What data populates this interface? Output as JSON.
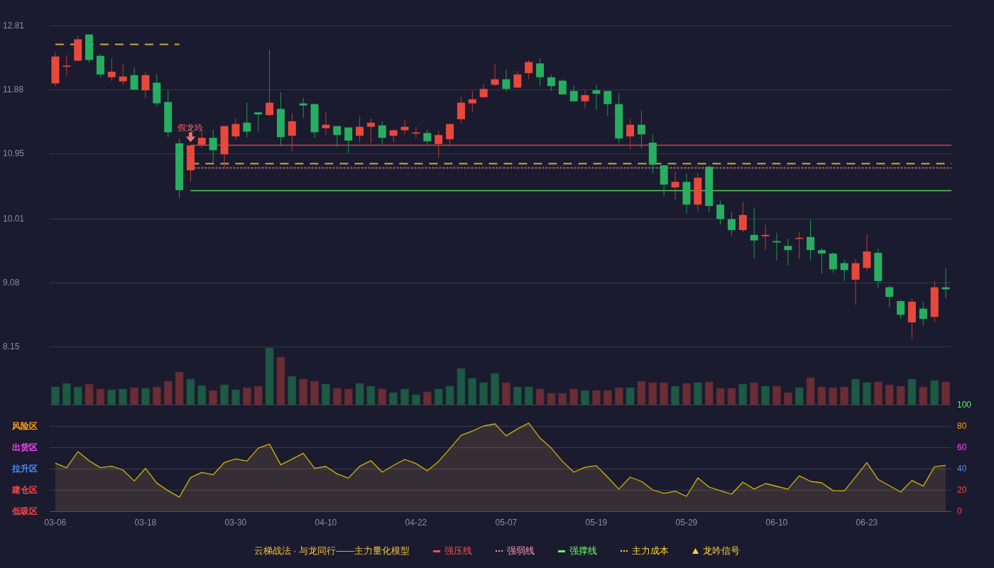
{
  "price_chart": {
    "chart_data": {
      "type": "candlestick",
      "categories": [
        null,
        null,
        null,
        null,
        null,
        null,
        null,
        null,
        null,
        null,
        null,
        null,
        null,
        null,
        null,
        null,
        null,
        null,
        null,
        null,
        null,
        null,
        null,
        null,
        null,
        null,
        null,
        null,
        null,
        null,
        null,
        null,
        null,
        null,
        null,
        null,
        null,
        null,
        null,
        null,
        null,
        null,
        null,
        null,
        null,
        null,
        null,
        null,
        null,
        null,
        null,
        null,
        null,
        null,
        null,
        null,
        null,
        null,
        null,
        null,
        null,
        null,
        null,
        null,
        null,
        null,
        null,
        null,
        null,
        null,
        null,
        null,
        null,
        null,
        null,
        null,
        null,
        null,
        null,
        null
      ],
      "ohlc": [
        [
          11.97,
          12.42,
          11.93,
          12.36
        ],
        [
          12.21,
          12.38,
          12.08,
          12.22
        ],
        [
          12.3,
          12.66,
          12.29,
          12.61
        ],
        [
          12.68,
          12.68,
          12.27,
          12.31
        ],
        [
          12.37,
          12.4,
          12.06,
          12.1
        ],
        [
          12.06,
          12.33,
          12.01,
          12.14
        ],
        [
          12.0,
          12.25,
          11.95,
          12.07
        ],
        [
          12.09,
          12.2,
          11.88,
          11.88
        ],
        [
          11.87,
          12.14,
          11.76,
          12.09
        ],
        [
          11.98,
          12.1,
          11.63,
          11.68
        ],
        [
          11.7,
          11.87,
          11.19,
          11.26
        ],
        [
          11.1,
          11.17,
          10.31,
          10.42
        ],
        [
          10.71,
          11.07,
          10.54,
          11.07
        ],
        [
          11.08,
          11.31,
          11.03,
          11.18
        ],
        [
          11.18,
          11.3,
          10.82,
          11.0
        ],
        [
          10.94,
          11.35,
          10.76,
          11.35
        ],
        [
          11.2,
          11.46,
          11.15,
          11.38
        ],
        [
          11.4,
          11.69,
          11.19,
          11.27
        ],
        [
          11.55,
          11.55,
          11.27,
          11.52
        ],
        [
          11.51,
          12.46,
          11.5,
          11.69
        ],
        [
          11.6,
          11.84,
          11.06,
          11.19
        ],
        [
          11.21,
          11.54,
          10.99,
          11.42
        ],
        [
          11.68,
          11.76,
          11.47,
          11.65
        ],
        [
          11.67,
          11.67,
          11.18,
          11.26
        ],
        [
          11.32,
          11.55,
          11.22,
          11.37
        ],
        [
          11.35,
          11.35,
          11.05,
          11.22
        ],
        [
          11.33,
          11.33,
          10.96,
          11.14
        ],
        [
          11.21,
          11.49,
          11.11,
          11.34
        ],
        [
          11.34,
          11.46,
          11.1,
          11.4
        ],
        [
          11.36,
          11.42,
          11.08,
          11.18
        ],
        [
          11.21,
          11.3,
          11.12,
          11.29
        ],
        [
          11.29,
          11.44,
          11.22,
          11.34
        ],
        [
          11.24,
          11.34,
          11.18,
          11.25
        ],
        [
          11.25,
          11.3,
          11.07,
          11.13
        ],
        [
          11.09,
          11.28,
          10.89,
          11.22
        ],
        [
          11.16,
          11.39,
          11.05,
          11.38
        ],
        [
          11.45,
          11.78,
          11.39,
          11.69
        ],
        [
          11.68,
          11.86,
          11.56,
          11.74
        ],
        [
          11.77,
          11.96,
          11.76,
          11.89
        ],
        [
          11.95,
          12.25,
          11.93,
          12.03
        ],
        [
          12.03,
          12.17,
          11.85,
          11.89
        ],
        [
          11.91,
          12.15,
          11.9,
          12.1
        ],
        [
          12.12,
          12.31,
          12.03,
          12.28
        ],
        [
          12.26,
          12.33,
          11.93,
          12.06
        ],
        [
          12.06,
          12.1,
          11.86,
          11.93
        ],
        [
          12.01,
          12.03,
          11.81,
          11.81
        ],
        [
          11.86,
          11.94,
          11.7,
          11.71
        ],
        [
          11.71,
          11.87,
          11.61,
          11.8
        ],
        [
          11.87,
          11.95,
          11.59,
          11.82
        ],
        [
          11.86,
          11.86,
          11.5,
          11.67
        ],
        [
          11.67,
          11.83,
          11.1,
          11.17
        ],
        [
          11.2,
          11.46,
          11.01,
          11.37
        ],
        [
          11.37,
          11.57,
          11.03,
          11.23
        ],
        [
          11.11,
          11.23,
          10.66,
          10.79
        ],
        [
          10.78,
          10.79,
          10.33,
          10.5
        ],
        [
          10.46,
          10.69,
          10.28,
          10.54
        ],
        [
          10.54,
          10.66,
          10.08,
          10.21
        ],
        [
          10.21,
          10.67,
          10.11,
          10.6
        ],
        [
          10.76,
          10.78,
          10.1,
          10.19
        ],
        [
          10.21,
          10.27,
          9.92,
          10.0
        ],
        [
          10.0,
          10.1,
          9.76,
          9.84
        ],
        [
          9.84,
          10.25,
          9.81,
          10.06
        ],
        [
          9.77,
          10.17,
          9.43,
          9.69
        ],
        [
          9.75,
          9.92,
          9.55,
          9.77
        ],
        [
          9.68,
          9.8,
          9.4,
          9.66
        ],
        [
          9.61,
          9.71,
          9.33,
          9.55
        ],
        [
          9.71,
          9.81,
          9.42,
          9.72
        ],
        [
          9.74,
          9.99,
          9.4,
          9.55
        ],
        [
          9.55,
          9.58,
          9.21,
          9.5
        ],
        [
          9.5,
          9.52,
          9.22,
          9.27
        ],
        [
          9.36,
          9.41,
          9.1,
          9.26
        ],
        [
          9.12,
          9.42,
          8.76,
          9.36
        ],
        [
          9.29,
          9.78,
          9.25,
          9.53
        ],
        [
          9.51,
          9.57,
          9.0,
          9.1
        ],
        [
          9.01,
          9.04,
          8.72,
          8.87
        ],
        [
          8.81,
          8.82,
          8.55,
          8.61
        ],
        [
          8.5,
          8.84,
          8.28,
          8.8
        ],
        [
          8.7,
          8.8,
          8.45,
          8.55
        ],
        [
          8.58,
          9.1,
          8.5,
          9.01
        ],
        [
          9.01,
          9.29,
          8.85,
          8.98
        ]
      ],
      "ylim": [
        8.15,
        12.81
      ],
      "yticks": [
        8.15,
        9.08,
        10.01,
        10.95,
        11.88,
        12.81
      ],
      "grid": true,
      "ref_lines": [
        {
          "axis": "y",
          "value": 12.54,
          "color": "#ffd23f"
        },
        {
          "axis": "y",
          "value": 11.08,
          "color": "#ff4d4d"
        },
        {
          "axis": "y",
          "value": 10.81,
          "color": "#ffd23f"
        },
        {
          "axis": "y",
          "value": 10.75,
          "color": "#ff99a8"
        },
        {
          "axis": "y",
          "value": 10.42,
          "color": "#66ff66"
        }
      ],
      "annotations": [
        "假龙吟"
      ]
    }
  },
  "indicator": {
    "zones": [
      {
        "color": "#44ff44"
      },
      {
        "label": "风险区",
        "color": "#ff9f1a"
      },
      {
        "label": "出货区",
        "color": "#ff44ff"
      },
      {
        "label": "拉升区",
        "color": "#4d8dff"
      },
      {
        "label": "建仓区",
        "color": "#ff4444"
      },
      {
        "label": "低吸区",
        "color": "#ff4444"
      }
    ],
    "chart_data": {
      "type": "area",
      "categories": [
        "03-06",
        null,
        null,
        null,
        null,
        null,
        null,
        null,
        "03-18",
        null,
        null,
        null,
        null,
        null,
        null,
        null,
        "03-30",
        null,
        null,
        null,
        null,
        null,
        null,
        null,
        "04-10",
        null,
        null,
        null,
        null,
        null,
        null,
        null,
        "04-22",
        null,
        null,
        null,
        null,
        null,
        null,
        null,
        "05-07",
        null,
        null,
        null,
        null,
        null,
        null,
        null,
        "05-19",
        null,
        null,
        null,
        null,
        null,
        null,
        null,
        "05-29",
        null,
        null,
        null,
        null,
        null,
        null,
        null,
        "06-10",
        null,
        null,
        null,
        null,
        null,
        null,
        null,
        "06-23",
        null,
        null,
        null,
        null,
        null,
        null,
        null
      ],
      "values": [
        45.1,
        40.7,
        56.0,
        47.3,
        40.9,
        42.2,
        38.7,
        28.4,
        40.2,
        26.4,
        19.3,
        13.3,
        31.6,
        36.4,
        34.2,
        45.8,
        49.1,
        47.1,
        59.3,
        62.9,
        43.6,
        48.9,
        54.4,
        40.2,
        42.0,
        35.1,
        31.1,
        42.2,
        47.5,
        36.7,
        43.0,
        48.7,
        44.7,
        38.0,
        46.7,
        58.7,
        71.3,
        75.3,
        80.0,
        82.0,
        70.7,
        77.3,
        82.7,
        68.7,
        59.3,
        46.7,
        36.7,
        41.3,
        42.7,
        32.0,
        20.7,
        32.0,
        28.0,
        20.0,
        16.7,
        18.7,
        14.0,
        31.3,
        22.7,
        19.3,
        16.0,
        27.3,
        20.7,
        26.0,
        23.3,
        20.7,
        33.3,
        28.0,
        26.7,
        19.3,
        19.1,
        32.2,
        45.6,
        29.8,
        24.0,
        18.0,
        28.9,
        23.6,
        41.8,
        43.1
      ],
      "ylim": [
        0,
        100
      ],
      "yticks": [
        100,
        80,
        60,
        40,
        20,
        0
      ],
      "grid": true
    }
  },
  "legend": {
    "title": "云梯战法 · 与龙同行——主力量化模型",
    "items": [
      {
        "label": "强压线",
        "kind": "solid",
        "color": "#ff4d4d"
      },
      {
        "label": "强弱线",
        "kind": "dotted",
        "color": "#ff99a8"
      },
      {
        "label": "强撑线",
        "kind": "solid",
        "color": "#66ff66"
      },
      {
        "label": "主力成本",
        "kind": "dashed",
        "color": "#ffd23f"
      },
      {
        "label": "龙吟信号",
        "kind": "triangle",
        "color": "#ffd23f"
      }
    ]
  }
}
